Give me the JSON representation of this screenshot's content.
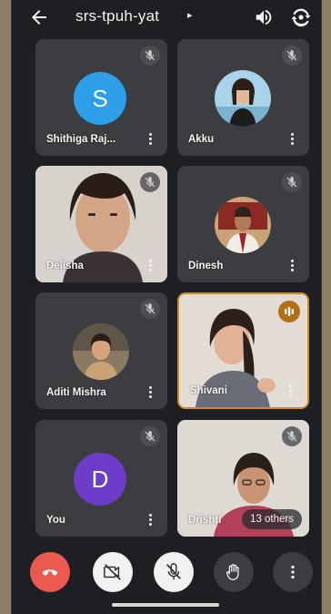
{
  "header": {
    "meeting_code": "srs-tpuh-yat",
    "caret": "▸",
    "back_icon": "arrow-back-icon",
    "speaker_icon": "speaker-icon",
    "camera_flip_icon": "camera-switch-icon"
  },
  "participants": [
    {
      "name": "Shithiga   Raj...",
      "avatar_type": "letter",
      "avatar_letter": "S",
      "avatar_color": "#2d9fe8",
      "mic_muted": true
    },
    {
      "name": "Akku",
      "avatar_type": "photo",
      "mic_muted": true
    },
    {
      "name": "Delisha",
      "avatar_type": "video",
      "mic_muted": true
    },
    {
      "name": "Dinesh",
      "avatar_type": "photo",
      "mic_muted": true
    },
    {
      "name": "Aditi   Mishra",
      "avatar_type": "photo",
      "mic_muted": true
    },
    {
      "name": "Shivani",
      "avatar_type": "video",
      "mic_muted": false,
      "speaking": true
    },
    {
      "name": "You",
      "avatar_type": "letter",
      "avatar_letter": "D",
      "avatar_color": "#6d3cc9",
      "mic_muted": true
    },
    {
      "name": "Drishti",
      "avatar_type": "video",
      "mic_muted": true,
      "others_label": "13 others"
    }
  ],
  "controls": [
    {
      "name": "end-call",
      "icon": "phone-hangup-icon",
      "color": "#ea5a4f"
    },
    {
      "name": "camera-off",
      "icon": "video-off-icon",
      "color": "#f1f1f1"
    },
    {
      "name": "mic-off",
      "icon": "mic-off-icon",
      "color": "#f1f1f1"
    },
    {
      "name": "raise-hand",
      "icon": "hand-icon",
      "color": "#3b3d40"
    },
    {
      "name": "more-options",
      "icon": "more-vert-icon",
      "color": "#3b3d40"
    }
  ]
}
